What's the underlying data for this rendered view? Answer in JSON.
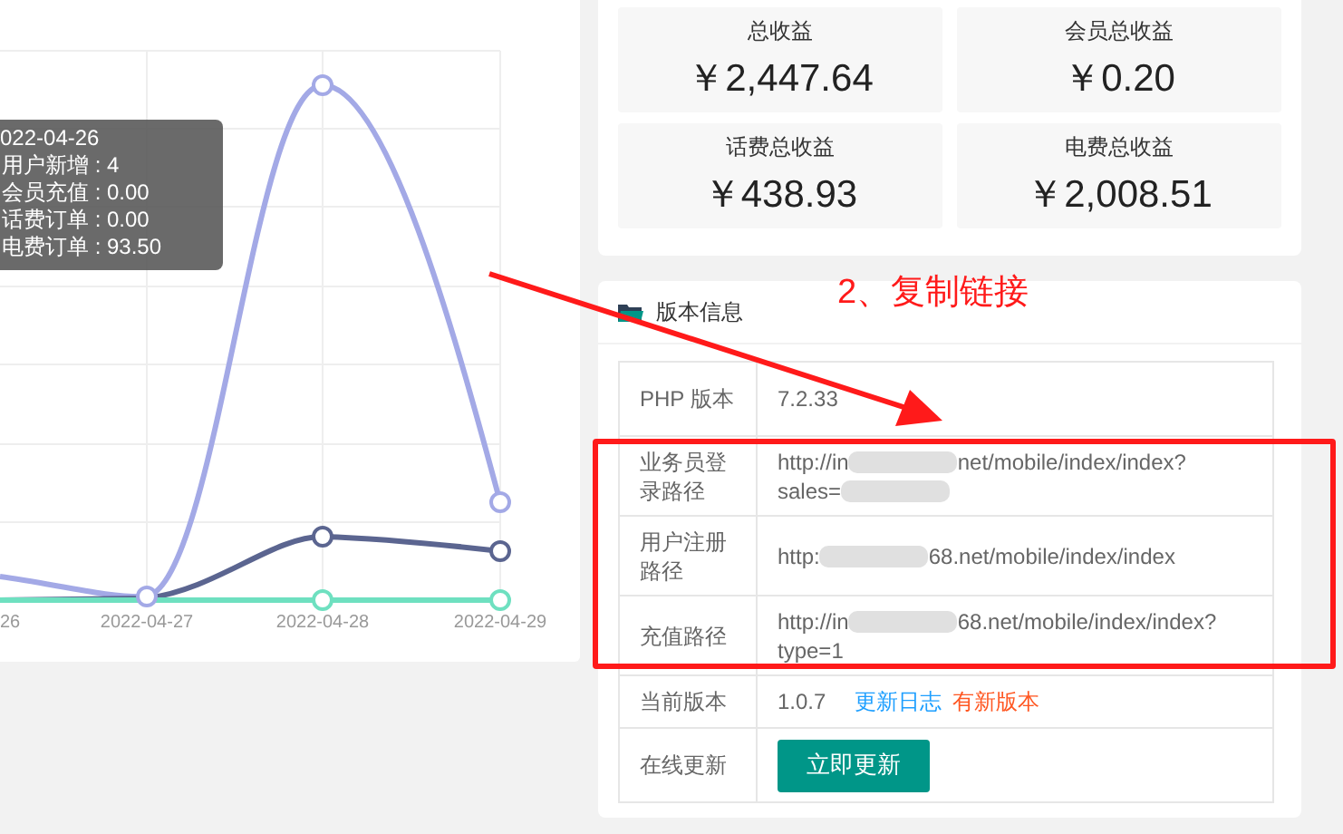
{
  "chart": {
    "x_labels": [
      "26",
      "2022-04-27",
      "2022-04-28",
      "2022-04-29"
    ],
    "tooltip": {
      "title": "022-04-26",
      "rows": [
        "用户新增 : 4",
        "会员充值 : 0.00",
        "话费订单 : 0.00",
        "电费订单 : 93.50"
      ]
    }
  },
  "stats": [
    {
      "label": "总收益",
      "value": "￥2,447.64"
    },
    {
      "label": "会员总收益",
      "value": "￥0.20"
    },
    {
      "label": "话费总收益",
      "value": "￥438.93"
    },
    {
      "label": "电费总收益",
      "value": "￥2,008.51"
    }
  ],
  "version": {
    "title": "版本信息",
    "rows": [
      {
        "kind": "text",
        "label": "PHP 版本",
        "value": "7.2.33"
      },
      {
        "kind": "url",
        "label": "业务员登录路径",
        "segments": [
          {
            "kind": "text",
            "text": "http://in"
          },
          {
            "kind": "redacted"
          },
          {
            "kind": "text",
            "text": "net/mobile/index/index?"
          },
          {
            "kind": "break"
          },
          {
            "kind": "text",
            "text": "sales="
          },
          {
            "kind": "redacted"
          }
        ]
      },
      {
        "kind": "url",
        "label": "用户注册路径",
        "segments": [
          {
            "kind": "text",
            "text": "http:"
          },
          {
            "kind": "redacted"
          },
          {
            "kind": "text",
            "text": "68.net/mobile/index/index"
          }
        ]
      },
      {
        "kind": "url",
        "label": "充值路径",
        "segments": [
          {
            "kind": "text",
            "text": "http://in"
          },
          {
            "kind": "redacted"
          },
          {
            "kind": "text",
            "text": "68.net/mobile/index/index?"
          },
          {
            "kind": "break"
          },
          {
            "kind": "text",
            "text": "type=1"
          }
        ]
      },
      {
        "kind": "version",
        "label": "当前版本",
        "value": "1.0.7",
        "links": [
          {
            "kind": "log",
            "text": "更新日志"
          },
          {
            "kind": "new",
            "text": "有新版本"
          }
        ]
      },
      {
        "kind": "button",
        "label": "在线更新",
        "button": "立即更新"
      }
    ]
  },
  "annotation": {
    "note": "2、复制链接"
  }
}
